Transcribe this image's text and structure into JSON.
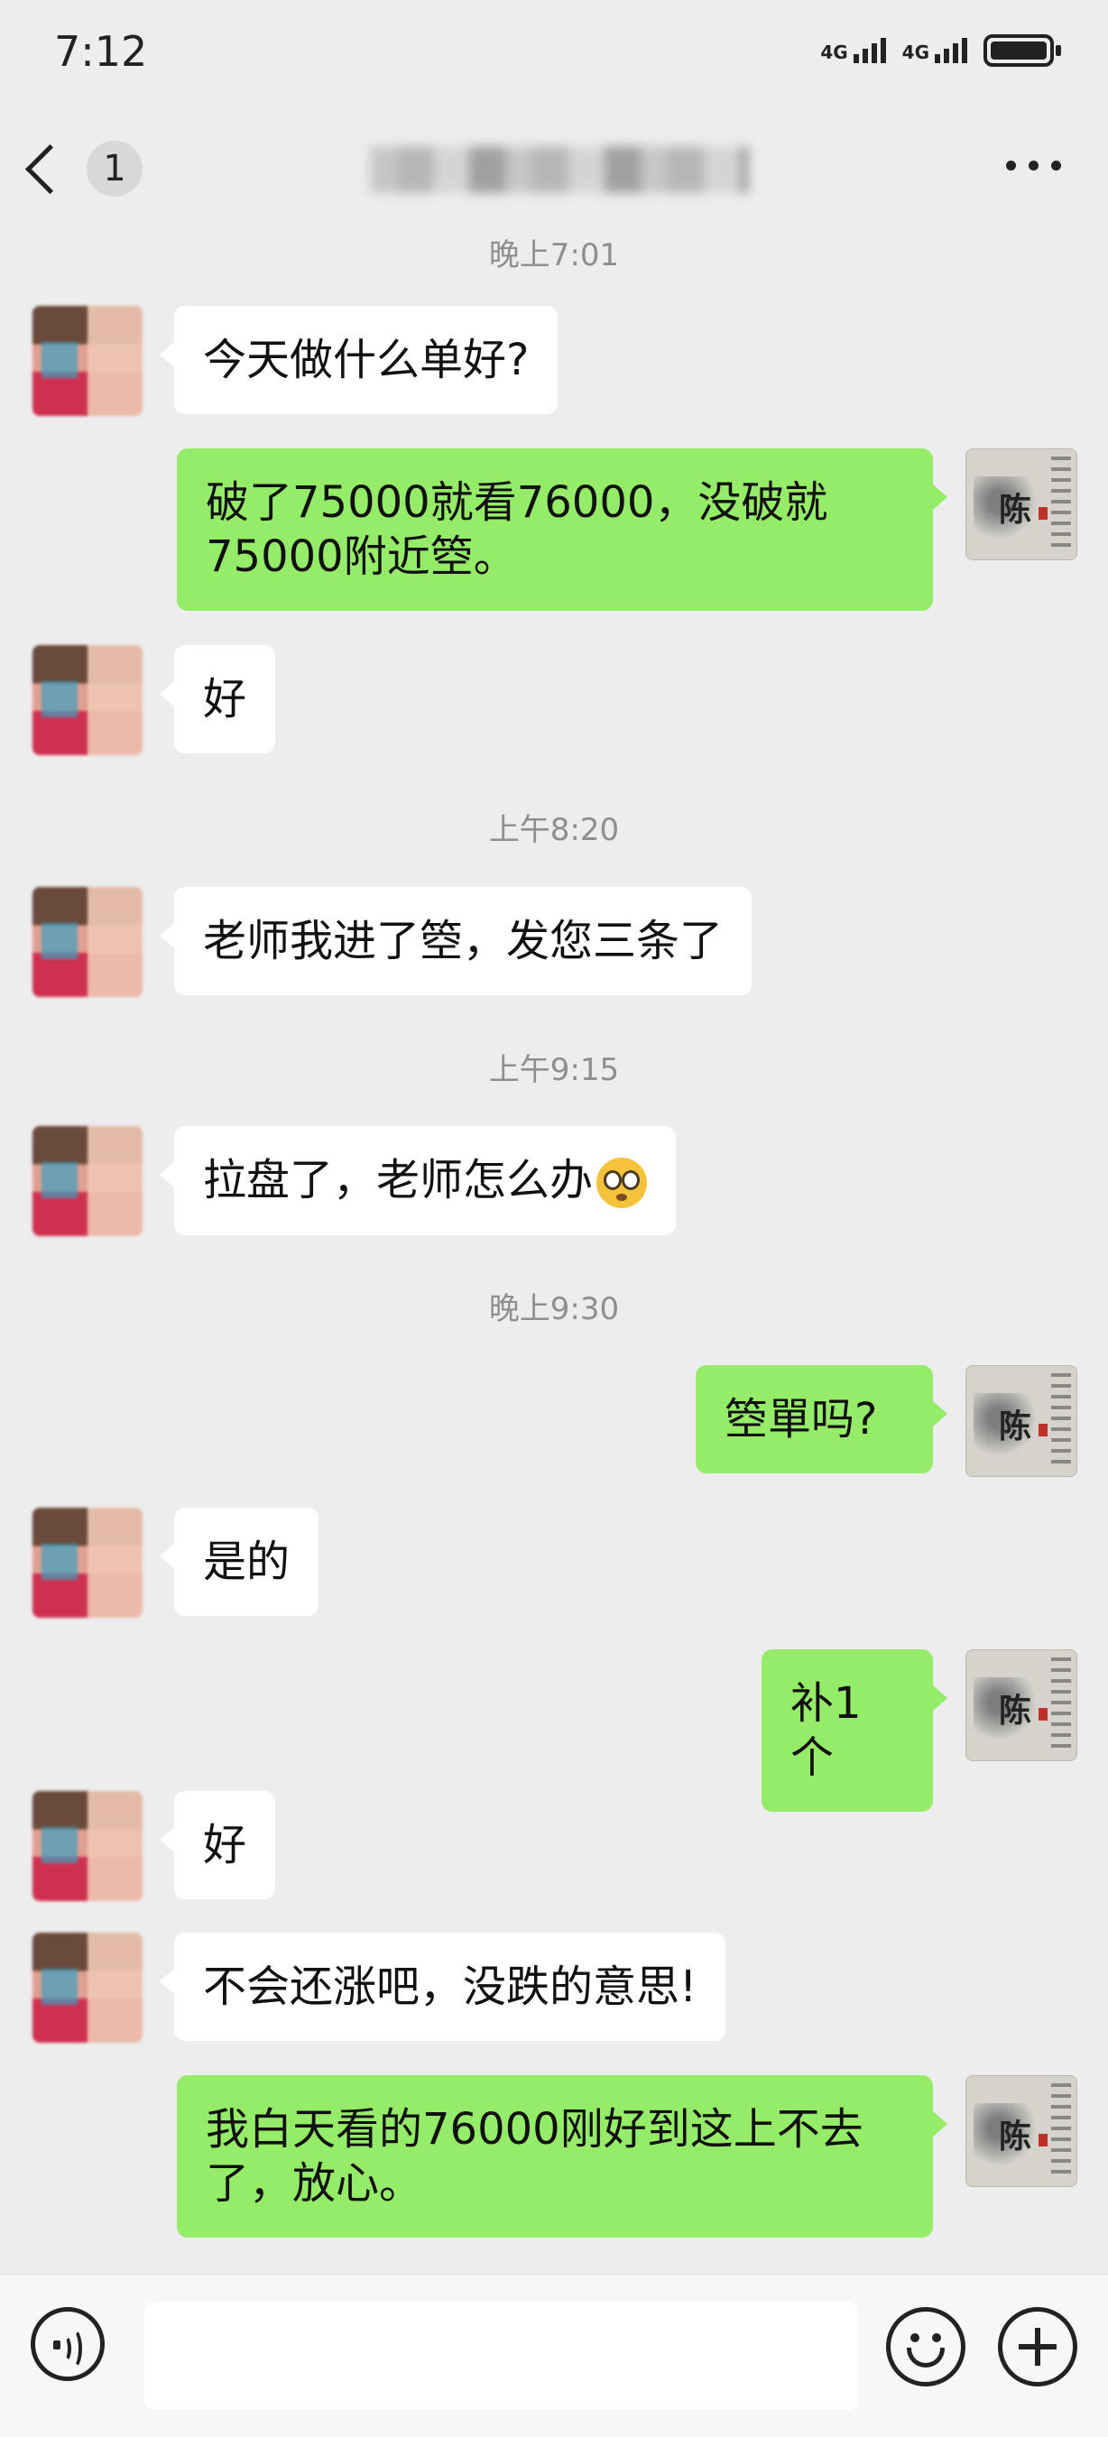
{
  "status_bar": {
    "time": "7:12",
    "network1": "4G",
    "network2": "4G"
  },
  "header": {
    "unread_count": "1",
    "title": "",
    "title_obscured": true
  },
  "messages": [
    {
      "type": "timestamp",
      "text": "晚上7:01"
    },
    {
      "type": "in",
      "text": "今天做什么单好?"
    },
    {
      "type": "out",
      "text": "破了75000就看76000，没破就75000附近箜。"
    },
    {
      "type": "in",
      "text": "好"
    },
    {
      "type": "timestamp",
      "text": "上午8:20"
    },
    {
      "type": "in",
      "text": "老师我进了箜，发您三条了"
    },
    {
      "type": "timestamp",
      "text": "上午9:15"
    },
    {
      "type": "in",
      "text": "拉盘了，老师怎么办",
      "emoji": "flushed-face-emoji"
    },
    {
      "type": "timestamp",
      "text": "晚上9:30"
    },
    {
      "type": "out",
      "text": "箜單吗?"
    },
    {
      "type": "in",
      "text": "是的"
    },
    {
      "type": "out",
      "text": "补1个"
    },
    {
      "type": "in",
      "text": "好"
    },
    {
      "type": "in",
      "text": "不会还涨吧，没跌的意思!"
    },
    {
      "type": "out",
      "text": "我白天看的76000刚好到这上不去了，放心。"
    }
  ],
  "input_bar": {
    "placeholder": "",
    "icons": [
      "voice-icon",
      "emoji-icon",
      "plus-icon"
    ]
  },
  "colors": {
    "background": "#ededed",
    "incoming_bubble": "#ffffff",
    "outgoing_bubble": "#95ec69",
    "timestamp_text": "#8e8e8e"
  }
}
